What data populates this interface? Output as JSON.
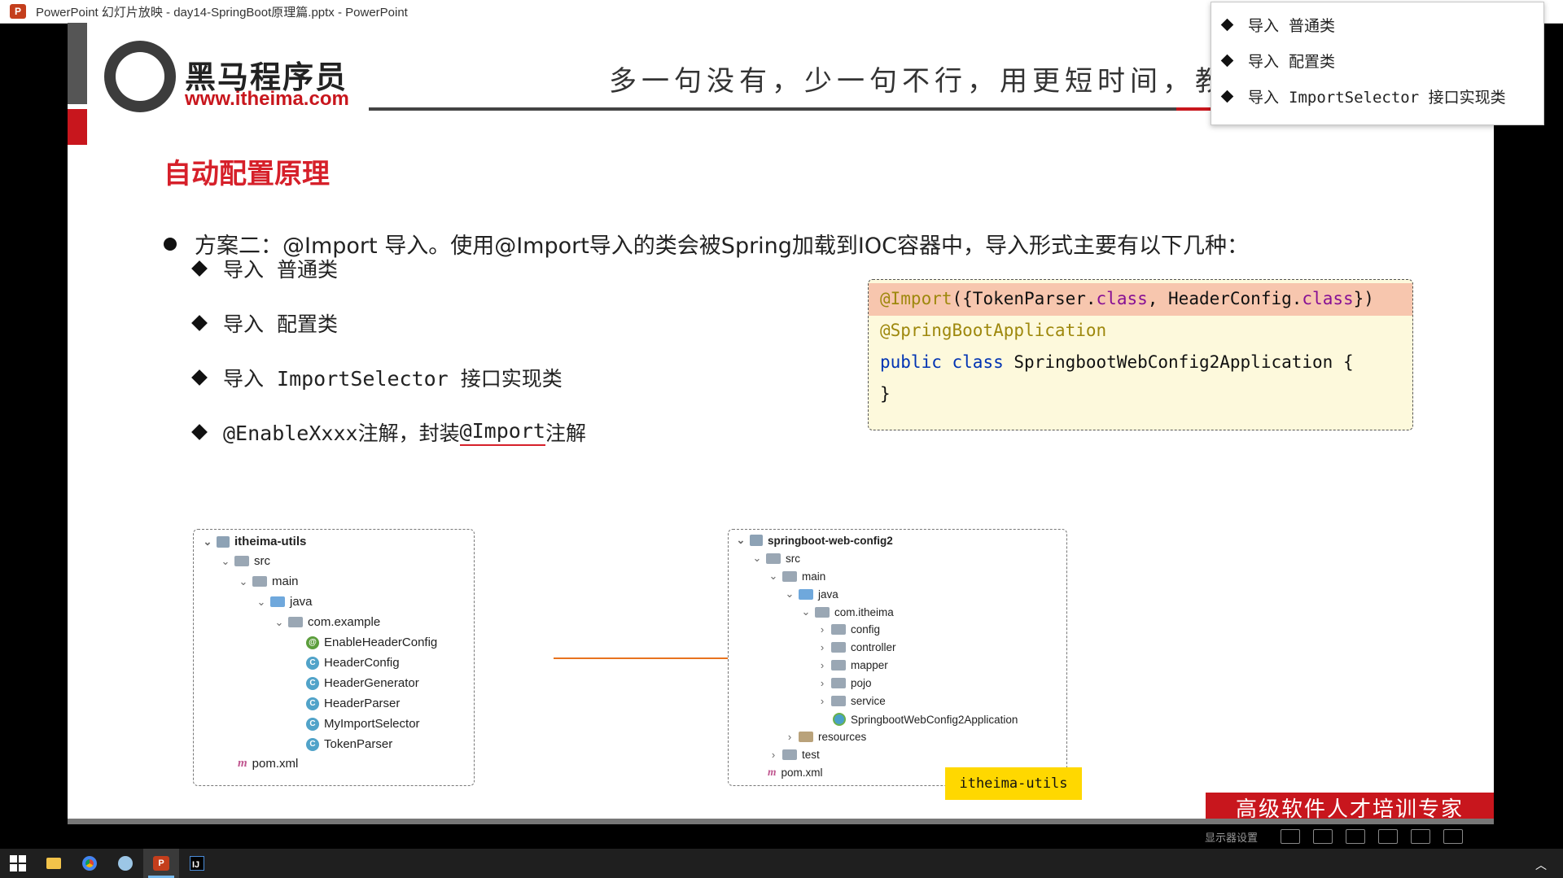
{
  "window": {
    "title": "PowerPoint 幻灯片放映  -  day14-SpringBoot原理篇.pptx - PowerPoint",
    "app_icon": "P"
  },
  "slide": {
    "logo": {
      "name_cn": "黑马程序员",
      "url": "www.itheima.com"
    },
    "slogan": "多一句没有，少一句不行，用更短时间，教会",
    "title": "自动配置原理",
    "main_bullet": "方案二：@Import 导入。使用@Import导入的类会被Spring加载到IOC容器中，导入形式主要有以下几种：",
    "sub_items": [
      {
        "prefix": "导入",
        "text": "普通类"
      },
      {
        "prefix": "导入",
        "text": "配置类"
      },
      {
        "prefix": "导入",
        "text": "ImportSelector 接口实现类"
      }
    ],
    "enable_item": {
      "pre": "@EnableXxxx注解，封装",
      "underlined": "@Import",
      "post": "注解"
    },
    "code": {
      "line1": {
        "anno": "@Import",
        "a": "({TokenParser.",
        "kw1": "class",
        "b": ", HeaderConfig.",
        "kw2": "class",
        "c": "})"
      },
      "line2": "@SpringBootApplication",
      "line3": {
        "kw1": "public",
        "kw2": "class",
        "rest": "SpringbootWebConfig2Application {"
      },
      "line4": "}"
    },
    "left_tree": {
      "root": "itheima-utils",
      "src": "src",
      "main": "main",
      "java": "java",
      "package": "com.example",
      "classes": [
        "EnableHeaderConfig",
        "HeaderConfig",
        "HeaderGenerator",
        "HeaderParser",
        "MyImportSelector",
        "TokenParser"
      ],
      "pom": "pom.xml"
    },
    "right_tree": {
      "root": "springboot-web-config2",
      "src": "src",
      "main": "main",
      "java": "java",
      "package": "com.itheima",
      "folders": [
        "config",
        "controller",
        "mapper",
        "pojo",
        "service"
      ],
      "app_class": "SpringbootWebConfig2Application",
      "resources": "resources",
      "test": "test",
      "pom": "pom.xml"
    },
    "yellow_label": "itheima-utils",
    "footer_slogan": "高级软件人才培训专家"
  },
  "popup_outline": {
    "items": [
      {
        "prefix": "导入",
        "text": "普通类"
      },
      {
        "prefix": "导入",
        "text": "配置类"
      },
      {
        "prefix": "导入",
        "text": "ImportSelector 接口实现类"
      }
    ]
  },
  "show_controls": {
    "display_settings": "显示器设置"
  },
  "colors": {
    "title_red": "#d6202a",
    "code_bg": "#fdf9dc",
    "code_highlight": "#f7c6ae",
    "arrow": "#e8731f",
    "label_yellow": "#ffd800"
  }
}
